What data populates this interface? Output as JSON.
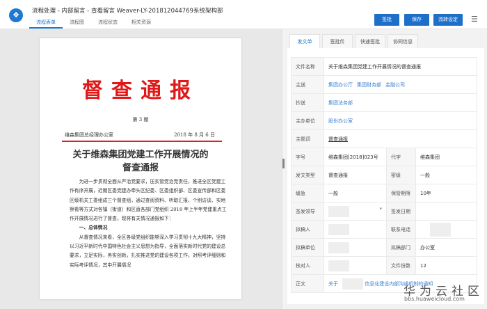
{
  "header": {
    "title": "流程处理 - 内部留言 - 查看留言 Weaver-LY-201812044769系统架构部",
    "tabs": [
      "流程表单",
      "流程图",
      "流程状态",
      "相关资源"
    ],
    "buttons": [
      "签批",
      "保存",
      "流转设定"
    ]
  },
  "document": {
    "masthead": "督查通报",
    "issue": "第 3 期",
    "org": "维森集团总经理办公室",
    "date": "2018 年 8 月 6 日",
    "title_line1": "关于维森集团党建工作开展情况的",
    "title_line2": "督查通报",
    "para1": "为进一步贯彻全面从严治党要求，压实管党治党责任，推进全区党建工作有序开展，近期区委党建办牵头区纪委、区委组织部、区委宣传部和区委区级机关工委组成三个督查组，通过查阅资料、听取汇报、个别访谈、实地察看等方式对各镇（街道）和区直各部门党组织 2018 年上半年党建重点工作开展情况进行了督查，现将有关情况通报如下：",
    "section1": "一、总体情况",
    "para2": "从督查情况来看，全区各级党组织能够深入学习贯彻十九大精神，坚持以习近平新时代中国特色社会主义思想为指导，全面落实新时代党的建设总要求，立足实际，务实创新，扎实推进党的建设各项工作，对照考评细则和实际考评情况，其中开展情况"
  },
  "right_tabs": [
    "发文单",
    "签批件",
    "快速签批",
    "协同信息"
  ],
  "form": {
    "file_name_label": "文件名称",
    "file_name": "关于维森集团党建工作开展情况的督查通报",
    "to_label": "主送",
    "to": [
      "集团办公厅",
      "集团财务部",
      "金融公司"
    ],
    "cc_label": "抄送",
    "cc": "集团法务部",
    "host_label": "主办单位",
    "host": "股份办公室",
    "keyword_label": "主题词",
    "keyword": "督查通报",
    "docno_label": "字号",
    "docno": "维森集团[2018]023号",
    "code_label": "代字",
    "code": "维森集团",
    "type_label": "发文类型",
    "type": "督查通报",
    "secret_label": "密级",
    "secret": "一般",
    "urgency_label": "缓急",
    "urgency": "一般",
    "retention_label": "保管期限",
    "retention": "10年",
    "signer_label": "签发领导",
    "sign_date_label": "签发日期",
    "drafter_label": "拟稿人",
    "phone_label": "联系电话",
    "draft_unit_label": "拟稿单位",
    "draft_dept_label": "拟稿部门",
    "draft_dept": "办公室",
    "checker_label": "核对人",
    "copies_label": "文件份数",
    "copies": "12",
    "body_label": "正文",
    "body_prefix": "关于",
    "body_suffix": "信息化建设内部沟通机制的通知"
  },
  "watermark": {
    "brand": "华为云社区",
    "url": "bbs.huaweicloud.com"
  }
}
